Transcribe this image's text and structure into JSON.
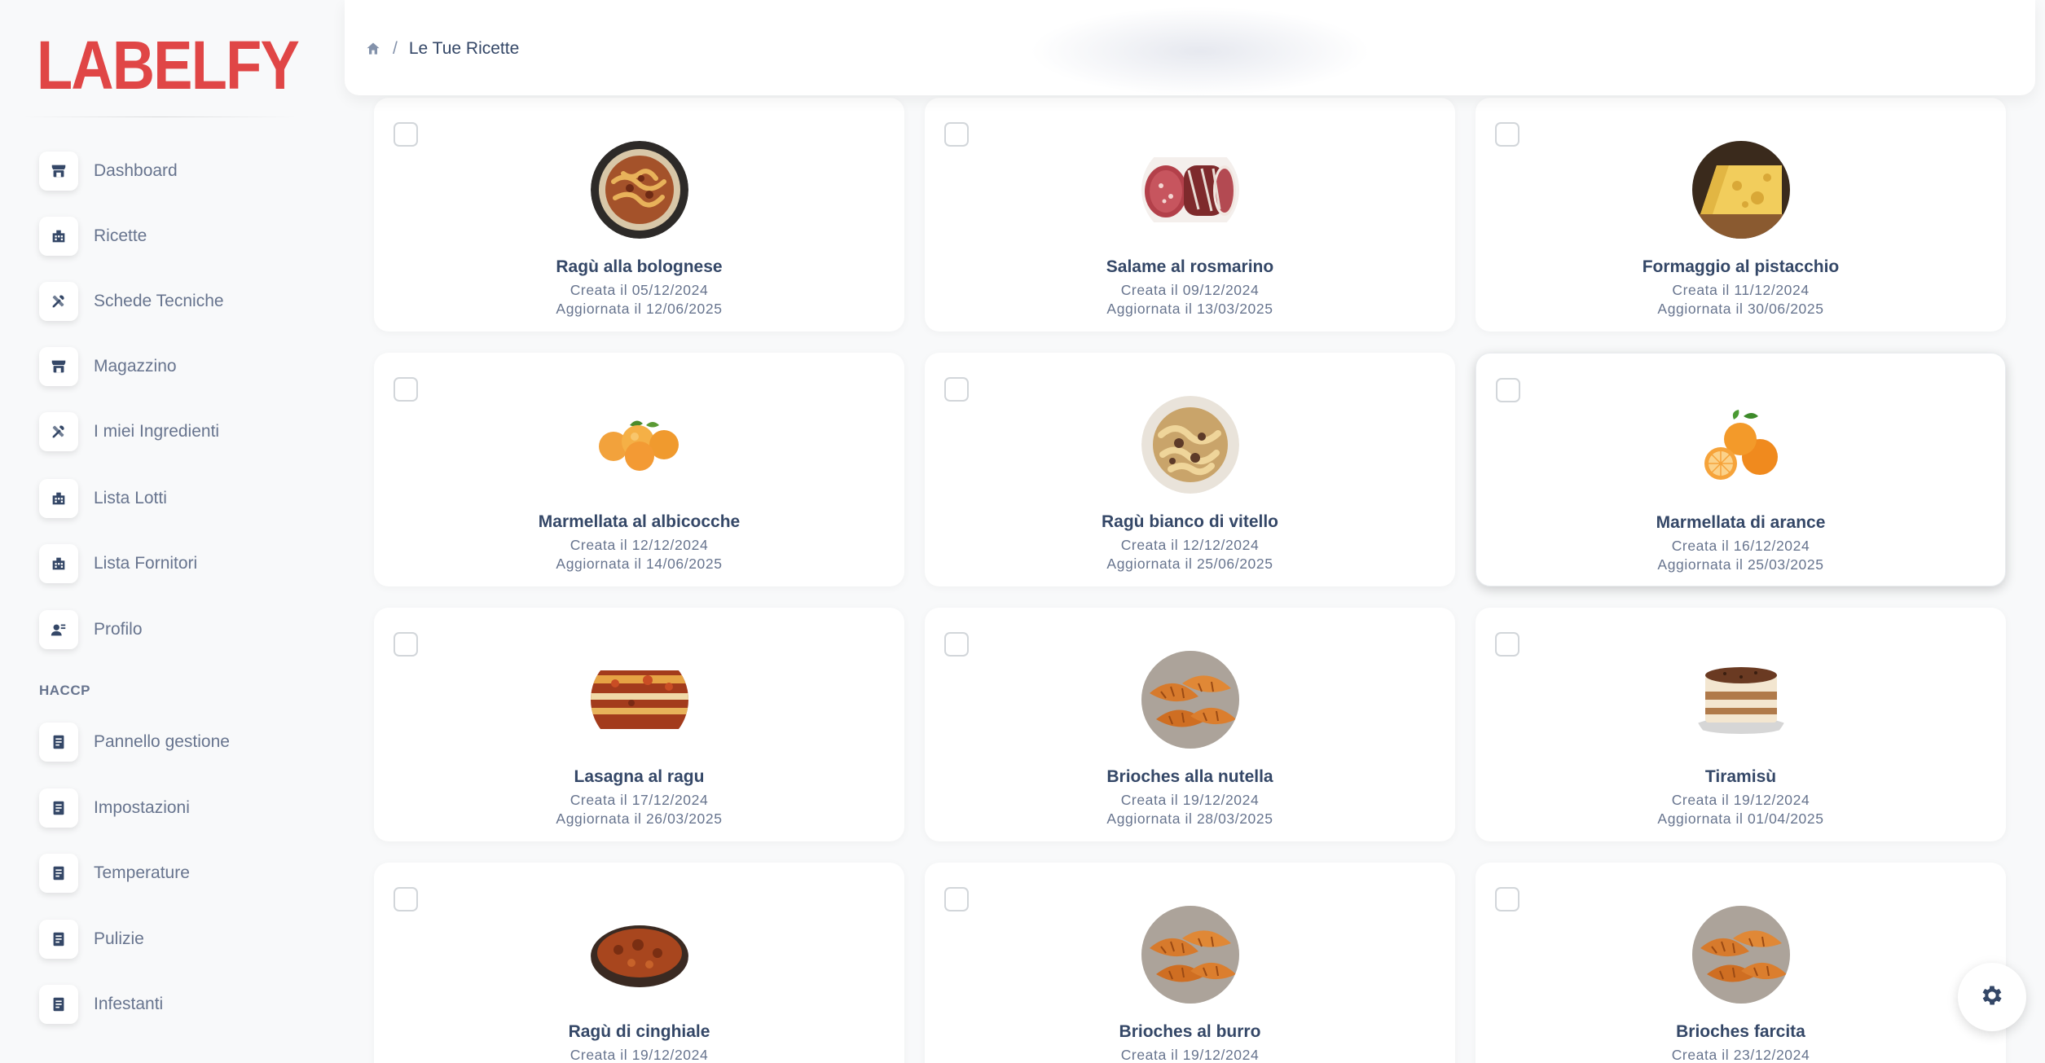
{
  "app": {
    "logo": "LABELFY",
    "accent": "#e04646"
  },
  "breadcrumb": {
    "home_icon": "home-icon",
    "separator": "/",
    "current": "Le Tue Ricette"
  },
  "sidebar": {
    "items": [
      {
        "label": "Dashboard",
        "icon": "shop-icon"
      },
      {
        "label": "Ricette",
        "icon": "office-icon"
      },
      {
        "label": "Schede Tecniche",
        "icon": "tools-icon"
      },
      {
        "label": "Magazzino",
        "icon": "shop-icon"
      },
      {
        "label": "I miei Ingredienti",
        "icon": "tools-icon"
      },
      {
        "label": "Lista Lotti",
        "icon": "office-icon"
      },
      {
        "label": "Lista Fornitori",
        "icon": "office-icon"
      },
      {
        "label": "Profilo",
        "icon": "user-icon"
      }
    ],
    "section_title": "HACCP",
    "haccp_items": [
      {
        "label": "Pannello gestione",
        "icon": "document-icon"
      },
      {
        "label": "Impostazioni",
        "icon": "document-icon"
      },
      {
        "label": "Temperature",
        "icon": "document-icon"
      },
      {
        "label": "Pulizie",
        "icon": "document-icon"
      },
      {
        "label": "Infestanti",
        "icon": "document-icon"
      }
    ]
  },
  "recipes": [
    {
      "title": "Ragù alla bolognese",
      "created": "Creata il 05/12/2024",
      "updated": "Aggiornata il 12/06/2025",
      "image": "pasta-bolognese"
    },
    {
      "title": "Salame al rosmarino",
      "created": "Creata il 09/12/2024",
      "updated": "Aggiornata il 13/03/2025",
      "image": "salami"
    },
    {
      "title": "Formaggio al pistacchio",
      "created": "Creata il 11/12/2024",
      "updated": "Aggiornata il 30/06/2025",
      "image": "cheese"
    },
    {
      "title": "Marmellata al albicocche",
      "created": "Creata il 12/12/2024",
      "updated": "Aggiornata il 14/06/2025",
      "image": "apricots"
    },
    {
      "title": "Ragù bianco di vitello",
      "created": "Creata il 12/12/2024",
      "updated": "Aggiornata il 25/06/2025",
      "image": "pasta-white"
    },
    {
      "title": "Marmellata di arance",
      "created": "Creata il 16/12/2024",
      "updated": "Aggiornata il 25/03/2025",
      "image": "oranges"
    },
    {
      "title": "Lasagna al ragu",
      "created": "Creata il 17/12/2024",
      "updated": "Aggiornata il 26/03/2025",
      "image": "lasagna"
    },
    {
      "title": "Brioches alla nutella",
      "created": "Creata il 19/12/2024",
      "updated": "Aggiornata il 28/03/2025",
      "image": "croissants"
    },
    {
      "title": "Tiramisù",
      "created": "Creata il 19/12/2024",
      "updated": "Aggiornata il 01/04/2025",
      "image": "tiramisu"
    },
    {
      "title": "Ragù di cinghiale",
      "created": "Creata il 19/12/2024",
      "updated": "",
      "image": "ragu-pot"
    },
    {
      "title": "Brioches al burro",
      "created": "Creata il 19/12/2024",
      "updated": "",
      "image": "croissants"
    },
    {
      "title": "Brioches farcita",
      "created": "Creata il 23/12/2024",
      "updated": "",
      "image": "croissants"
    }
  ],
  "fab": {
    "icon": "gear-icon"
  }
}
